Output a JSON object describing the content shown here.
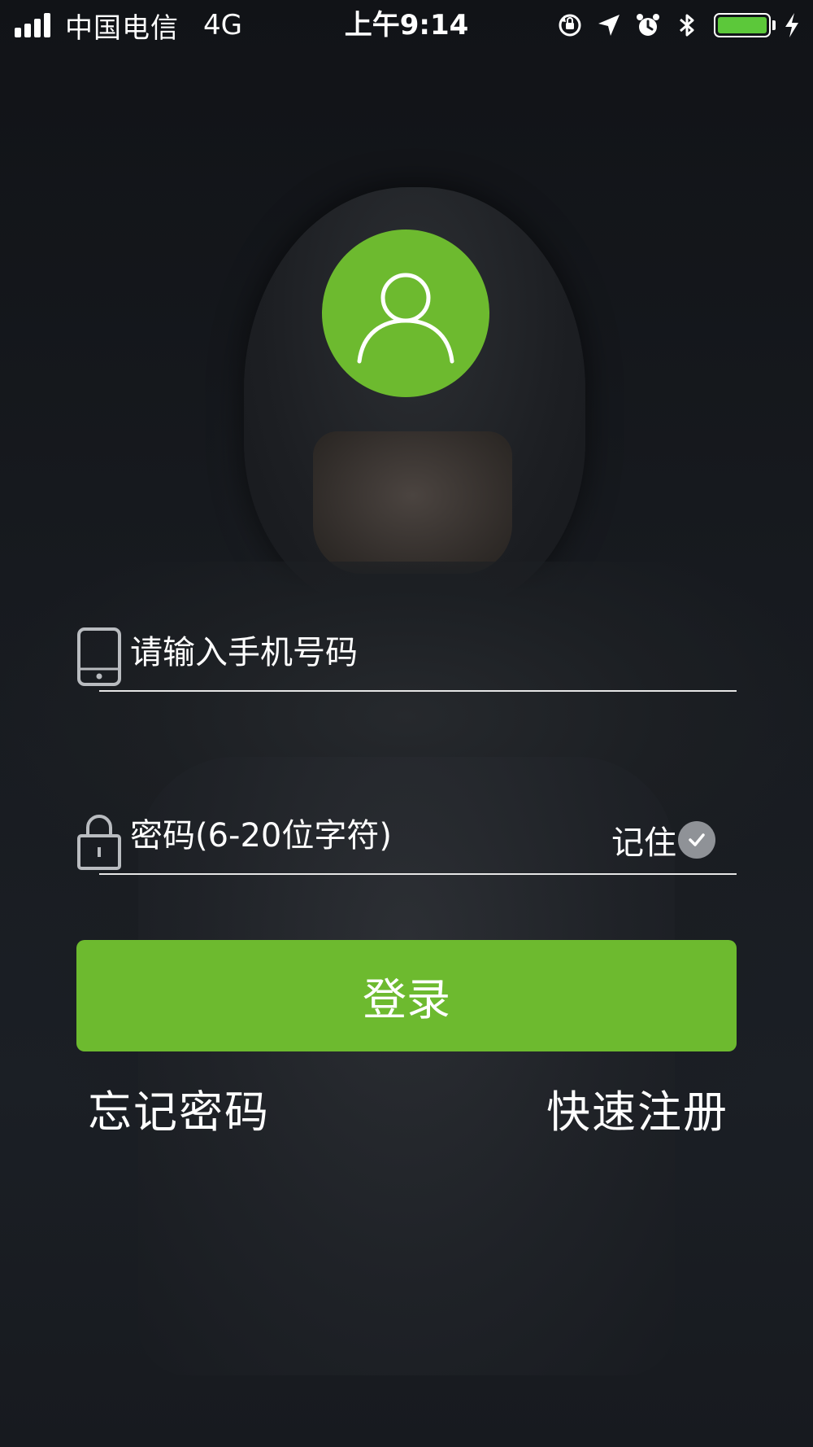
{
  "status_bar": {
    "carrier": "中国电信",
    "network": "4G",
    "time": "上午9:14",
    "icons": [
      "signal-icon",
      "orientation-lock-icon",
      "location-arrow-icon",
      "alarm-icon",
      "bluetooth-icon",
      "battery-icon",
      "charging-icon"
    ],
    "battery_level": 1.0,
    "battery_color": "#5cc83a"
  },
  "avatar": {
    "icon": "user-icon",
    "color": "#6dba2f"
  },
  "form": {
    "phone": {
      "icon": "phone-icon",
      "placeholder": "请输入手机号码",
      "value": ""
    },
    "password": {
      "icon": "lock-icon",
      "placeholder": "密码(6-20位字符)",
      "value": "",
      "remember_label": "记住",
      "remember_checked": true
    }
  },
  "login_button": {
    "label": "登录",
    "color": "#6dba2f"
  },
  "links": {
    "forgot_password": "忘记密码",
    "quick_register": "快速注册"
  }
}
